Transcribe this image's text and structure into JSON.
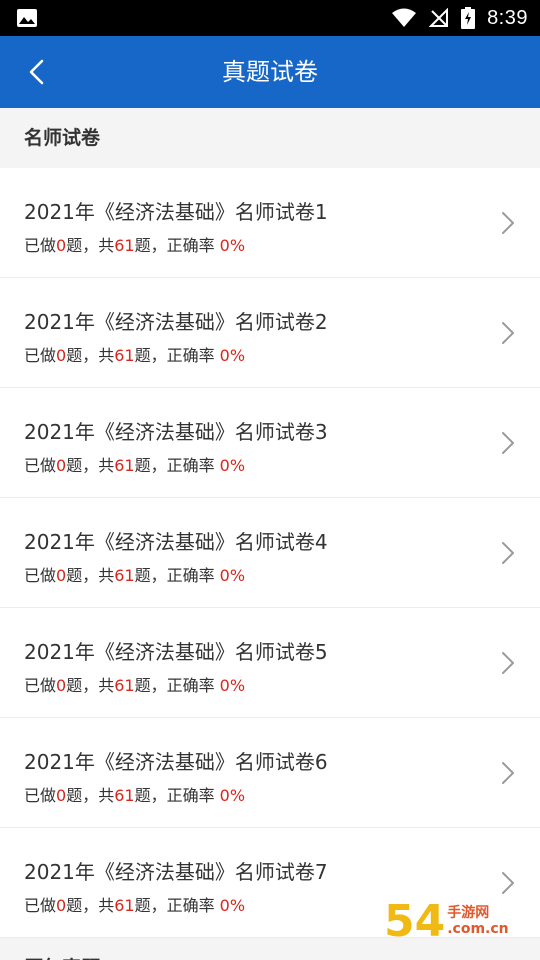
{
  "status_bar": {
    "time": "8:39"
  },
  "app_bar": {
    "title": "真题试卷"
  },
  "sections": [
    {
      "header": "名师试卷"
    },
    {
      "header": "历年真题"
    }
  ],
  "papers": [
    {
      "name": "2021年《经济法基础》名师试卷1",
      "done_prefix": "已做",
      "done": "0",
      "mid": "题，共",
      "total": "61",
      "suffix": "题，正确率 ",
      "rate": "0%"
    },
    {
      "name": "2021年《经济法基础》名师试卷2",
      "done_prefix": "已做",
      "done": "0",
      "mid": "题，共",
      "total": "61",
      "suffix": "题，正确率 ",
      "rate": "0%"
    },
    {
      "name": "2021年《经济法基础》名师试卷3",
      "done_prefix": "已做",
      "done": "0",
      "mid": "题，共",
      "total": "61",
      "suffix": "题，正确率 ",
      "rate": "0%"
    },
    {
      "name": "2021年《经济法基础》名师试卷4",
      "done_prefix": "已做",
      "done": "0",
      "mid": "题，共",
      "total": "61",
      "suffix": "题，正确率 ",
      "rate": "0%"
    },
    {
      "name": "2021年《经济法基础》名师试卷5",
      "done_prefix": "已做",
      "done": "0",
      "mid": "题，共",
      "total": "61",
      "suffix": "题，正确率 ",
      "rate": "0%"
    },
    {
      "name": "2021年《经济法基础》名师试卷6",
      "done_prefix": "已做",
      "done": "0",
      "mid": "题，共",
      "total": "61",
      "suffix": "题，正确率 ",
      "rate": "0%"
    },
    {
      "name": "2021年《经济法基础》名师试卷7",
      "done_prefix": "已做",
      "done": "0",
      "mid": "题，共",
      "total": "61",
      "suffix": "题，正确率 ",
      "rate": "0%"
    }
  ],
  "watermark": {
    "number": "54",
    "line1": "手游网",
    "line2": ".com.cn"
  },
  "colors": {
    "app_bar": "#1667c8",
    "accent_red": "#d9261c",
    "section_bg": "#f4f4f4"
  }
}
